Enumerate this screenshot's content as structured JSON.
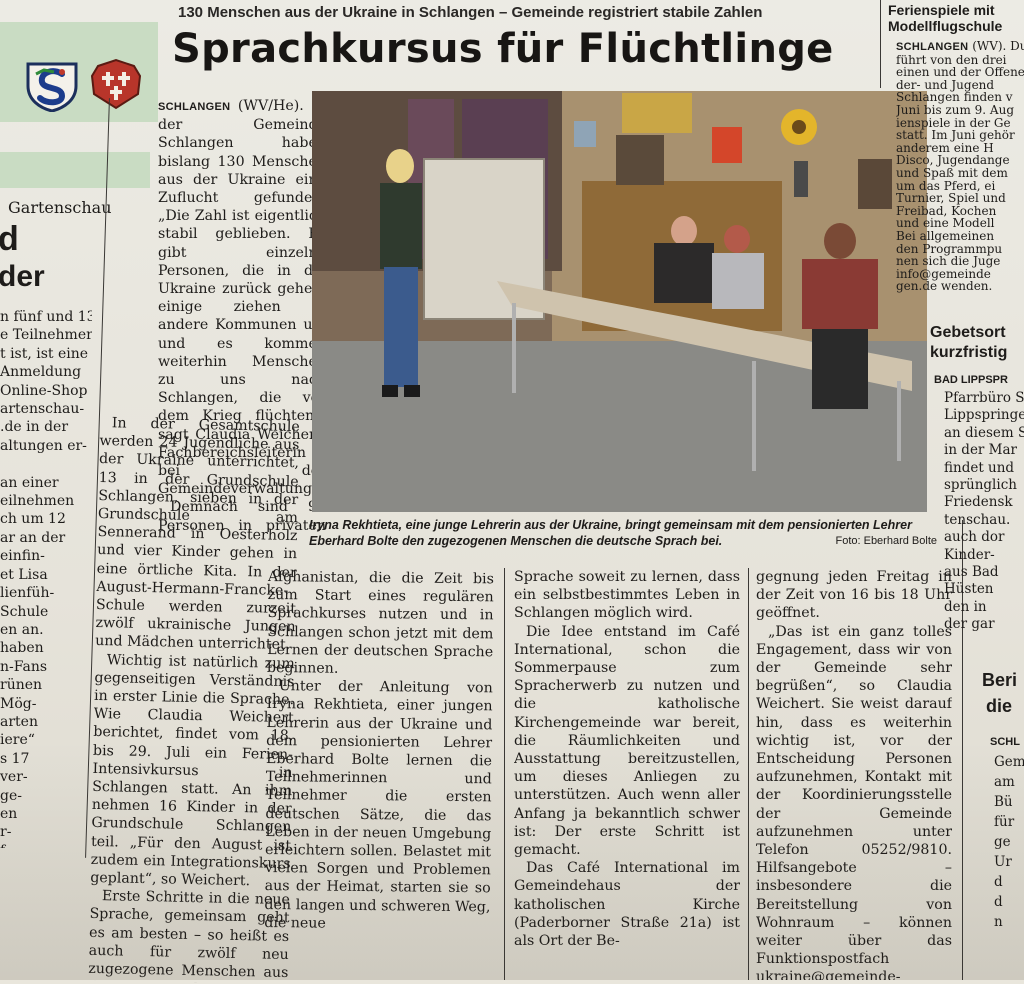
{
  "article": {
    "kicker": "130 Menschen aus der Ukraine in Schlangen – Gemeinde registriert stabile Zahlen",
    "headline": "Sprachkursus für Flüchtlinge",
    "dateline": "SCHLANGEN",
    "col1_intro": " (WV/He). In der Gemeinde Schlangen haben bislang 130 Menschen aus der Ukraine eine Zuflucht gefunden. „Die Zahl ist eigentlich stabil geblieben. Es gibt einzelne Personen, die in die Ukraine zurück gehen, einige ziehen in andere Kommunen um und es kommen weiterhin Menschen zu uns nach Schlangen, die vor dem Krieg flüchten“, sagt Claudia Weichert, Fachbereichsleiterin bei der Gemeindeverwaltung.",
    "col1_p2": "Demnach sind 91 Personen in privaten Unterkünften untergekommen, acht in kommunalen Gebäuden und 31 haben selbst privat eine Mietwohnung gefunden.",
    "col1_p3": "In der Gesamtschule werden 24 Jugendliche aus der Ukraine unterrichtet, 13 in der Grundschule Schlangen, sieben in der Grundschule am Sennerand in Oesterholz und vier Kinder gehen in eine örtliche Kita. In der August-Hermann-Francke-Schule werden zurzeit zwölf ukrainische Jungen und Mädchen unterrichtet.",
    "col1_p4": "Wichtig ist natürlich zum gegenseitigen Verständnis in erster Linie die Sprache. Wie Claudia Weichert berichtet, findet vom 18. bis 29. Juli ein Ferien-Intensivkursus in Schlangen statt. An ihm nehmen 16 Kinder in der Grundschule Schlangen teil. „Für den August ist zudem ein Integrationskurs geplant“, so Weichert.",
    "col1_p5": "Erste Schritte in die neue Sprache, gemeinsam geht es am besten – so heißt es auch für zwölf neu zugezogene Menschen aus der Ukraine, aber auch aus Syrien und",
    "col2": "Afghanistan, die die Zeit bis zum Start eines regulären Sprachkurses nutzen und in Schlangen schon jetzt mit dem Lernen der deutschen Sprache beginnen.",
    "col2_p2": "Unter der Anleitung von Iryna Rekhtieta, einer jungen Lehrerin aus der Ukraine und dem pensionierten Lehrer Eberhard Bolte lernen die Teilnehmerinnen und Teilnehmer die ersten deutschen Sätze, die das Leben in der neuen Umgebung erleichtern sollen. Belastet mit vielen Sorgen und Problemen aus der Heimat, starten sie so den langen und schweren Weg, die neue",
    "col3": "Sprache soweit zu lernen, dass ein selbstbestimmtes Leben in Schlangen möglich wird.",
    "col3_p2": "Die Idee entstand im Café International, schon die Sommerpause zum Spracherwerb zu nutzen und die katholische Kirchengemeinde war bereit, die Räumlichkeiten und Ausstattung bereitzustellen, um dieses Anliegen zu unterstützen. Auch wenn aller Anfang ja bekanntlich schwer ist: Der erste Schritt ist gemacht.",
    "col3_p3": "Das Café International im Gemeindehaus der katholischen Kirche (Paderborner Straße 21a) ist als Ort der Be-",
    "col4": "gegnung jeden Freitag in der Zeit von 16 bis 18 Uhr geöffnet.",
    "col4_p2": "„Das ist ein ganz tolles Engagement, dass wir von der Gemeinde sehr begrüßen“, so Claudia Weichert. Sie weist darauf hin, dass es weiterhin wichtig ist, vor der Entscheidung Personen aufzunehmen, Kontakt mit der Koordinierungsstelle der Gemeinde aufzunehmen unter Telefon 05252/9810. Hilfsangebote – insbesondere die Bereitstellung von Wohnraum – können weiter über das Funktionspostfach ukraine@gemeinde-schlangen.de gemeldet werden.",
    "caption": "Iryna Rekhtieta, eine junge Lehrerin aus der Ukraine, bringt gemeinsam mit dem pensionierten Lehrer Eberhard Bolte den zugezogenen Menschen die deutsche Sprach bei.",
    "credit": "Foto: Eberhard Bolte"
  },
  "left_column": {
    "section": "Gartenschau",
    "headline_fragment_1": "d",
    "headline_fragment_2": "der",
    "lines": [
      "n fünf und 13",
      "e Teilnehmer-",
      "t ist, ist eine",
      "Anmeldung",
      "Online-Shop",
      "artenschau-",
      ".de in der",
      "altungen er-",
      "",
      "an einer",
      "eilnehmen",
      "ch um 12",
      "ar an der",
      "einfin-",
      "et Lisa",
      "lienfüh-",
      "Schule",
      "en an.",
      "haben",
      "n-Fans",
      "rünen",
      "Mög-",
      "arten",
      "iere“",
      "s 17",
      "ver-",
      "ge-",
      "en",
      "r-",
      "f"
    ]
  },
  "right_column": {
    "top_head_1": "Ferienspiele mit",
    "top_head_2": "Modellflugschule",
    "dateline": "SCHLANGEN",
    "lines": [
      " (WV). Dur",
      "führt von den drei",
      "einen und der Offene",
      "der- und Jugend",
      "Schlangen finden v",
      "Juni bis zum 9. Aug",
      "ienspiele in der Ge",
      "statt. Im Juni gehör",
      "anderem eine H",
      "Disco, Jugendange",
      "und Spaß mit dem",
      "um das Pferd, ei",
      "Turnier, Spiel und",
      "Freibad, Kochen",
      "und eine Modell",
      "Bei allgemeinen",
      "den Programmpu",
      "nen sich die Juge",
      "info@gemeinde",
      "gen.de wenden."
    ],
    "head2_1": "Gebetsort",
    "head2_2": "kurzfristig",
    "dateline2": "BAD LIPPSPR",
    "lines2": [
      "Pfarrbüro S",
      "Lippspringe",
      "an diesem S",
      "in der Mar",
      "findet und",
      "sprünglich",
      "Friedensk",
      "tenschau.",
      "auch dor",
      "Kinder-",
      "aus Bad",
      "Hüsten",
      "den in",
      "der gar"
    ],
    "head3_1": "Beri",
    "head3_2": "die",
    "dateline3": "SCHL",
    "lines3": [
      "Gem",
      "am",
      "Bü",
      "für",
      "ge",
      "Ur",
      "d",
      "d",
      "n"
    ]
  },
  "colors": {
    "paper": "#e9e6dc",
    "green_band": "#c9dcc3",
    "ink": "#1e1c1a"
  },
  "icons": [
    "crest-left-icon",
    "crest-right-icon"
  ]
}
